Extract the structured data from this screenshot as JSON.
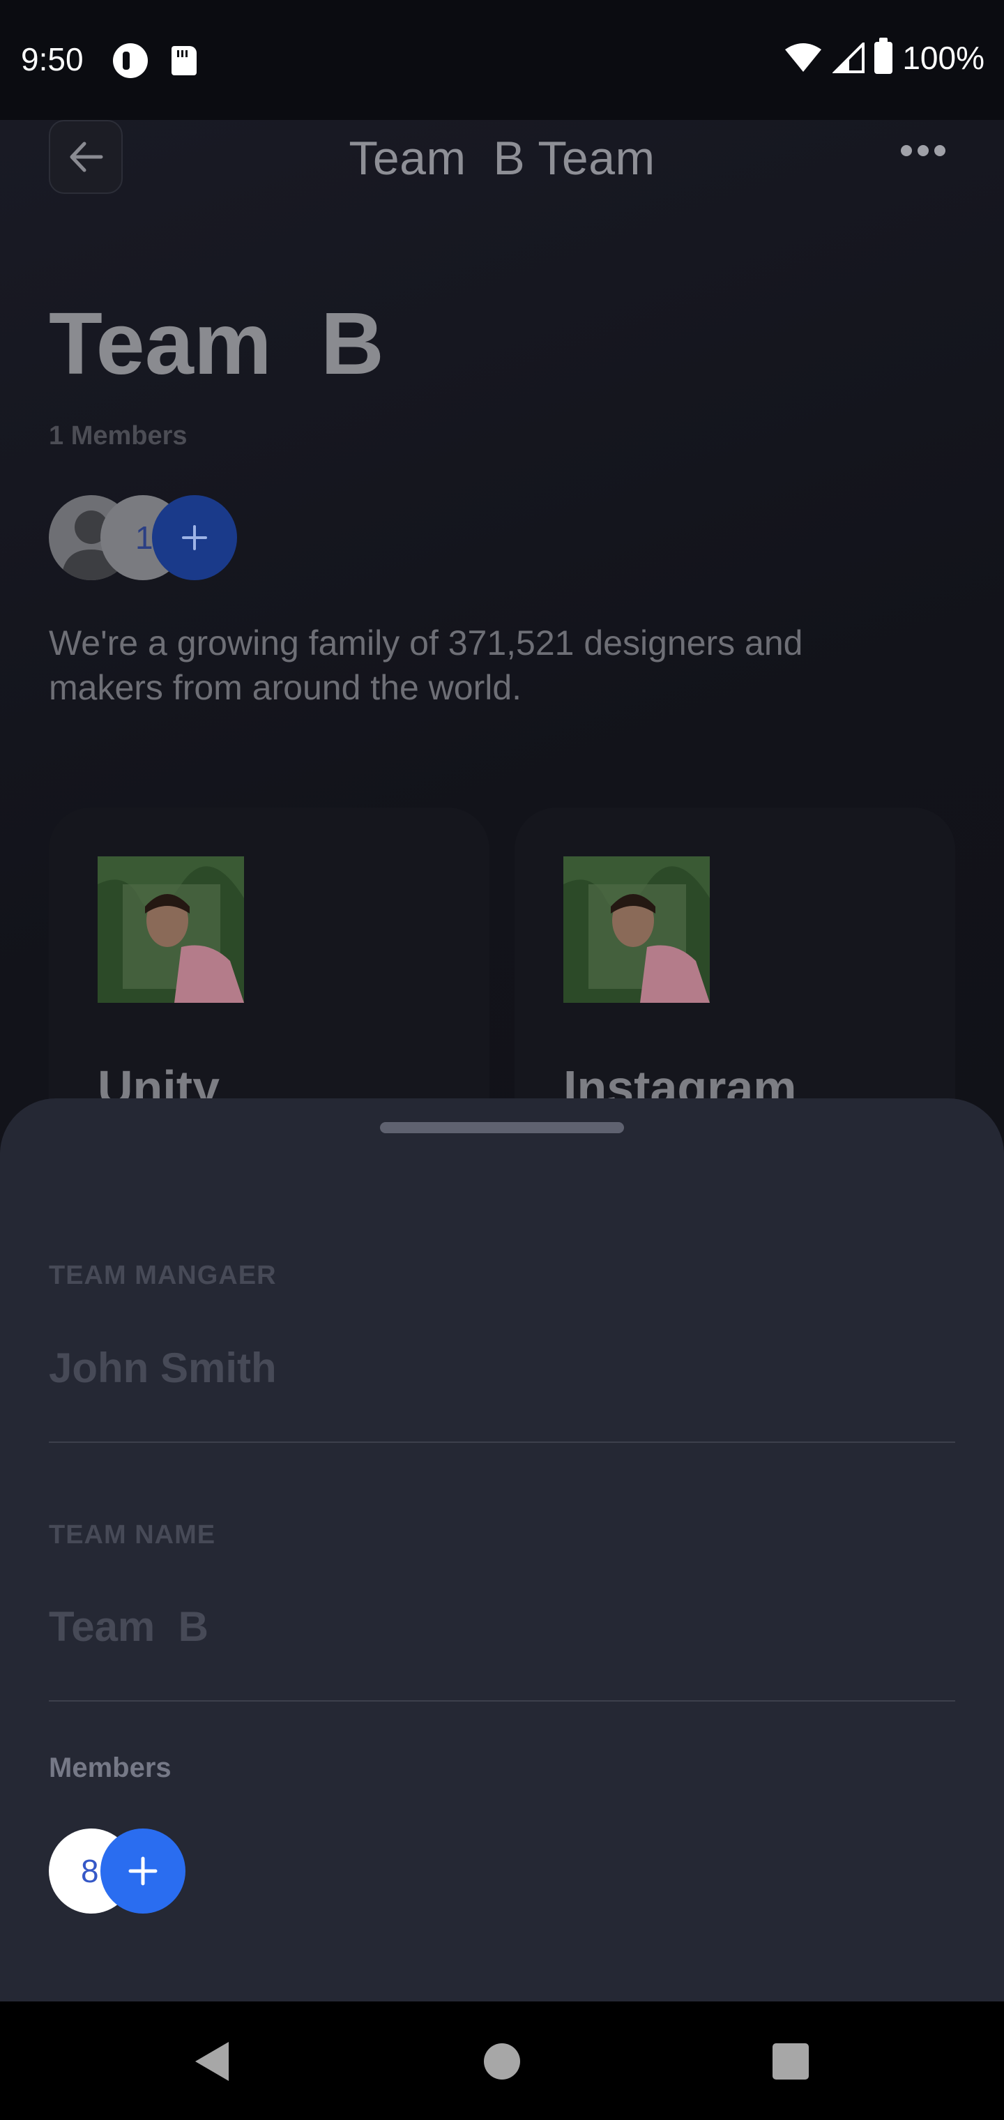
{
  "status_bar": {
    "time": "9:50",
    "battery": "100%"
  },
  "top_bar": {
    "title": "Team  B Team"
  },
  "team": {
    "name": "Team  B",
    "members_count": "1 Members",
    "avatar_count": "1",
    "description": "We're a growing family of 371,521 designers and makers from around the world."
  },
  "cards": [
    {
      "title": "Unity"
    },
    {
      "title": "Instagram"
    }
  ],
  "sheet": {
    "manager_label": "TEAM MANGAER",
    "manager_value": "John Smith",
    "team_name_label": "TEAM NAME",
    "team_name_value": "Team  B",
    "members_label": "Members",
    "members_count": "8"
  },
  "colors": {
    "accent_blue": "#2a6df0",
    "sheet_bg": "#252834"
  }
}
